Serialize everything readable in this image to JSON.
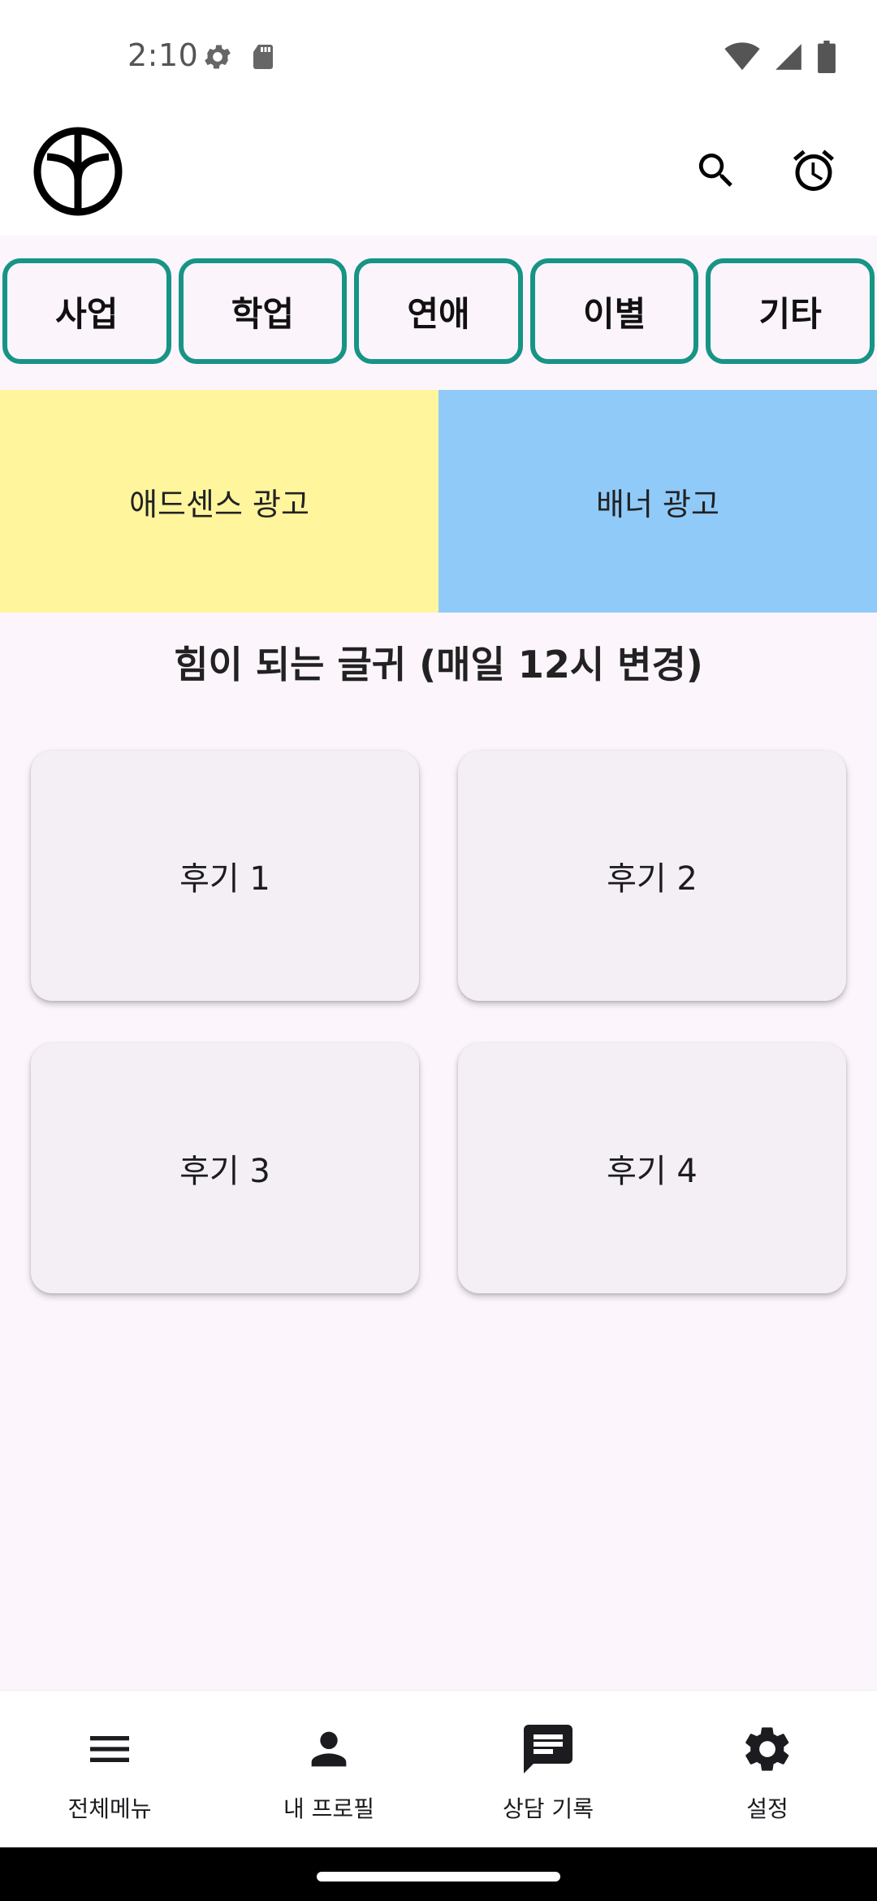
{
  "status_bar": {
    "time": "2:10",
    "left_icons": [
      "settings-gear-icon",
      "sd-card-icon"
    ],
    "right_icons": [
      "wifi-icon",
      "cellular-signal-icon",
      "battery-icon"
    ]
  },
  "app_bar": {
    "logo_icon": "peace-logo-icon",
    "actions": [
      "search-icon",
      "alarm-clock-icon"
    ]
  },
  "categories": [
    "사업",
    "학업",
    "연애",
    "이별",
    "기타"
  ],
  "ads": {
    "adsense_label": "애드센스 광고",
    "banner_label": "배너 광고",
    "adsense_color": "#fff59d",
    "banner_color": "#90caf9"
  },
  "section": {
    "title": "힘이 되는 글귀 (매일 12시 변경)"
  },
  "reviews": [
    {
      "label": "후기 1"
    },
    {
      "label": "후기 2"
    },
    {
      "label": "후기 3"
    },
    {
      "label": "후기 4"
    }
  ],
  "bottom_nav": [
    {
      "label": "전체메뉴",
      "icon": "menu-icon"
    },
    {
      "label": "내 프로필",
      "icon": "person-icon"
    },
    {
      "label": "상담 기록",
      "icon": "chat-icon"
    },
    {
      "label": "설정",
      "icon": "gear-icon"
    }
  ],
  "colors": {
    "accent": "#179486",
    "background": "#fcf5fc",
    "card": "#f3eff4"
  }
}
